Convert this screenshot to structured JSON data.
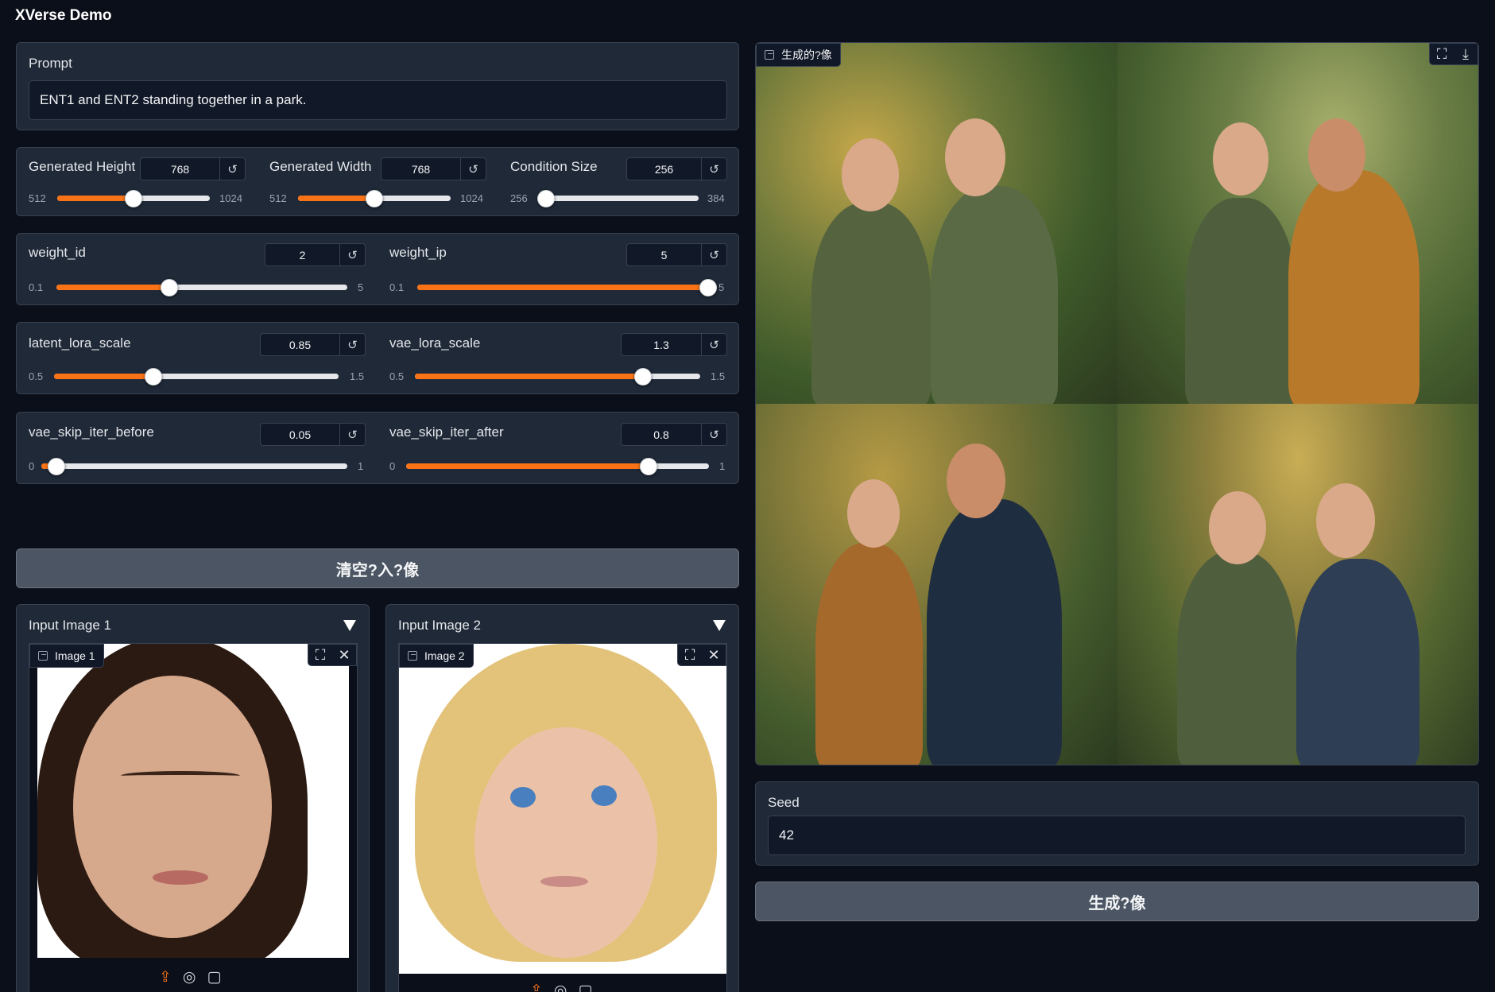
{
  "app": {
    "title": "XVerse Demo"
  },
  "prompt": {
    "label": "Prompt",
    "value": "ENT1 and ENT2 standing together in a park."
  },
  "sliders": {
    "height": {
      "label": "Generated Height",
      "value": "768",
      "min": "512",
      "max": "1024",
      "fraction": 0.5,
      "reset": "↺"
    },
    "width": {
      "label": "Generated Width",
      "value": "768",
      "min": "512",
      "max": "1024",
      "fraction": 0.5,
      "reset": "↺"
    },
    "condition": {
      "label": "Condition Size",
      "value": "256",
      "min": "256",
      "max": "384",
      "fraction": 0.0,
      "reset": "↺"
    },
    "weight_id": {
      "label": "weight_id",
      "value": "2",
      "min": "0.1",
      "max": "5",
      "fraction": 0.388,
      "reset": "↺"
    },
    "weight_ip": {
      "label": "weight_ip",
      "value": "5",
      "min": "0.1",
      "max": "5",
      "fraction": 1.0,
      "reset": "↺"
    },
    "latent_lora_scale": {
      "label": "latent_lora_scale",
      "value": "0.85",
      "min": "0.5",
      "max": "1.5",
      "fraction": 0.35,
      "reset": "↺"
    },
    "vae_lora_scale": {
      "label": "vae_lora_scale",
      "value": "1.3",
      "min": "0.5",
      "max": "1.5",
      "fraction": 0.8,
      "reset": "↺"
    },
    "vae_skip_iter_before": {
      "label": "vae_skip_iter_before",
      "value": "0.05",
      "min": "0",
      "max": "1",
      "fraction": 0.05,
      "reset": "↺"
    },
    "vae_skip_iter_after": {
      "label": "vae_skip_iter_after",
      "value": "0.8",
      "min": "0",
      "max": "1",
      "fraction": 0.8,
      "reset": "↺"
    }
  },
  "clear_button": {
    "label": "清空?入?像"
  },
  "inputs": [
    {
      "accordion_label": "Input Image 1",
      "tag": "Image 1"
    },
    {
      "accordion_label": "Input Image 2",
      "tag": "Image 2"
    }
  ],
  "output": {
    "tag": "生成的?像"
  },
  "seed": {
    "label": "Seed",
    "value": "42"
  },
  "generate_button": {
    "label": "生成?像"
  },
  "icons": {
    "reset": "reset-icon",
    "fullscreen": "fullscreen-icon",
    "download": "download-icon",
    "close": "close-icon",
    "upload": "upload-icon",
    "webcam": "webcam-icon",
    "clipboard": "clipboard-icon",
    "accordion": "triangle-down-icon"
  },
  "colors": {
    "accent": "#f97316",
    "background": "#0b0f19",
    "panel": "#1f2937"
  }
}
